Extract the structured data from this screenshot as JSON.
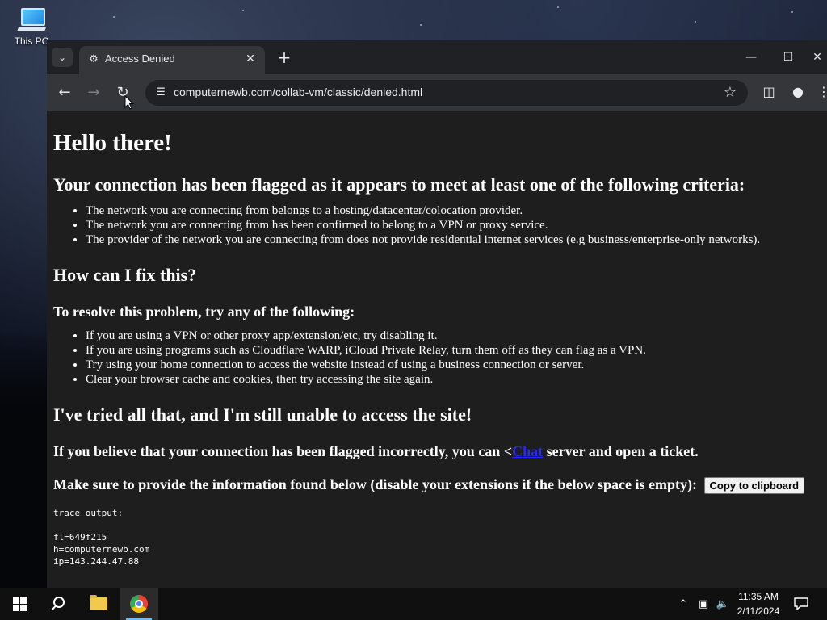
{
  "desktop": {
    "icons": [
      {
        "label": "This PC",
        "icon": "this-pc-icon"
      }
    ]
  },
  "browser": {
    "tab": {
      "title": "Access Denied",
      "favicon": "page-favicon-icon"
    },
    "window_controls": [
      "minimize",
      "maximize",
      "close"
    ],
    "address": {
      "url": "computernewb.com/collab-vm/classic/denied.html"
    }
  },
  "page": {
    "h1": "Hello there!",
    "criteria_heading": "Your connection has been flagged as it appears to meet at least one of the following criteria:",
    "criteria": [
      "The network you are connecting from belongs to a hosting/datacenter/colocation provider.",
      "The network you are connecting from has been confirmed to belong to a VPN or proxy service.",
      "The provider of the network you are connecting from does not provide residential internet services (e.g business/enterprise-only networks)."
    ],
    "fix_heading": "How can I fix this?",
    "resolve_heading": "To resolve this problem, try any of the following:",
    "fixes": [
      "If you are using a VPN or other proxy app/extension/etc, try disabling it.",
      "If you are using programs such as Cloudflare WARP, iCloud Private Relay, turn them off as they can flag as a VPN.",
      "Try using your home connection to access the website instead of using a business connection or server.",
      "Clear your browser cache and cookies, then try accessing the site again."
    ],
    "tried_heading": "I've tried all that, and I'm still unable to access the site!",
    "flagged_prefix": "If you believe that your connection has been flagged incorrectly, you can <",
    "flagged_link": "Chat",
    "flagged_suffix": " server and open a ticket.",
    "provide_info": "Make sure to provide the information found below (disable your extensions if the below space is empty):",
    "copy_button": "Copy to clipboard",
    "trace_label": "trace output:",
    "trace_lines": [
      "fl=649f215",
      "h=computernewb.com",
      "ip=143.244.47.88"
    ]
  },
  "taskbar": {
    "time": "11:35 AM",
    "date": "2/11/2024",
    "accent": "#76b9ed"
  }
}
